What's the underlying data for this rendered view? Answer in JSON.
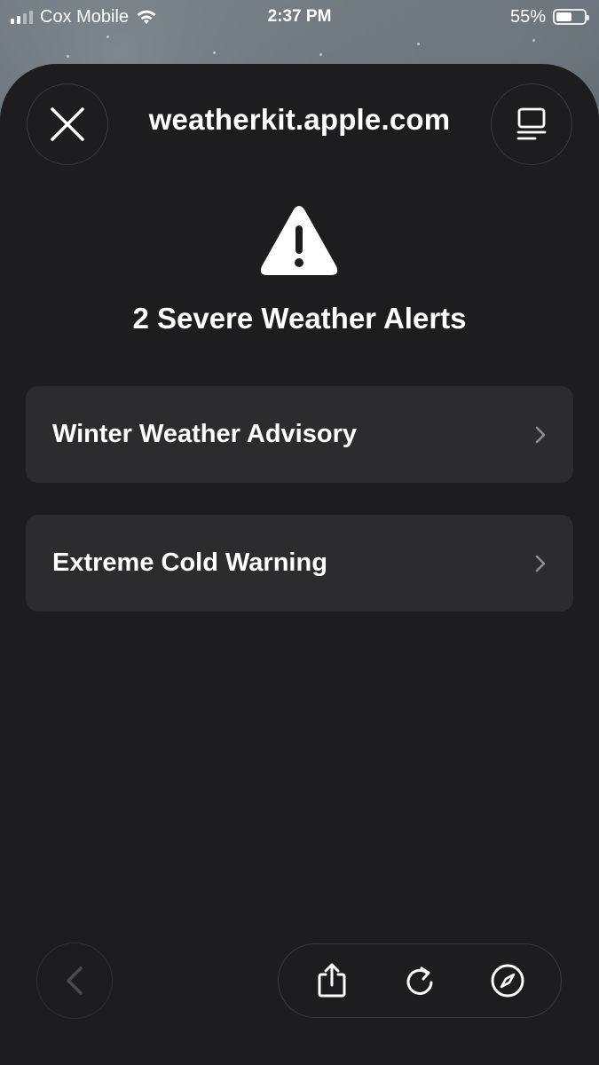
{
  "status_bar": {
    "carrier": "Cox Mobile",
    "time": "2:37 PM",
    "battery_percent": "55%",
    "battery_level": 0.55,
    "signal_bars_active": 2,
    "icons": [
      "signal-icon",
      "wifi-icon",
      "battery-icon"
    ]
  },
  "header": {
    "site": "weatherkit.apple.com",
    "close_icon": "close-icon",
    "reader_icon": "reader-view-icon"
  },
  "alerts": {
    "icon": "warning-triangle-icon",
    "heading": "2 Severe Weather Alerts",
    "items": [
      {
        "label": "Winter Weather Advisory"
      },
      {
        "label": "Extreme Cold Warning"
      }
    ]
  },
  "toolbar": {
    "back_icon": "chevron-left-icon",
    "share_icon": "share-icon",
    "reload_icon": "reload-icon",
    "safari_icon": "compass-icon"
  },
  "colors": {
    "sheet_bg": "#1d1d1f",
    "row_bg": "#2c2c2e",
    "text": "#ffffff",
    "chevron": "#8e8e93"
  }
}
